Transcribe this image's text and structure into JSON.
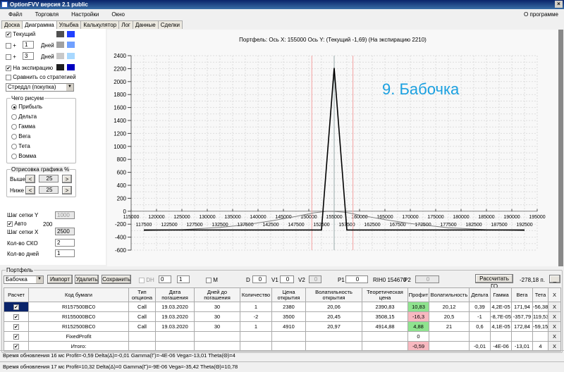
{
  "window": {
    "title": "OptionFVV версия 2.1 public"
  },
  "menu": [
    "Файл",
    "Торговля",
    "Настройки",
    "Окно"
  ],
  "about": "О программе",
  "tabs": [
    "Доска",
    "Диаграмма",
    "Улыбка",
    "Калькулятор",
    "Лог",
    "Данные",
    "Сделки"
  ],
  "left": {
    "current": "Текущий",
    "plus": "+",
    "days": "Дней",
    "days1": "1",
    "days2": "3",
    "expiry": "На экспирацию",
    "compare": "Сравнить со стратегией",
    "strategy": "Стреддл (покупка)",
    "draw_group": "Чего рисуем",
    "draw_options": [
      "Прибыль",
      "Дельта",
      "Гамма",
      "Вега",
      "Тета",
      "Вомма"
    ],
    "range_group": "Отрисовка графика %",
    "above": "Выше",
    "below": "Ниже",
    "above_val": "25",
    "below_val": "25",
    "lt": "<",
    "gt": ">",
    "grid_y": "Шаг сетки Y",
    "grid_y_val": "1000",
    "auto": "Авто",
    "auto_val": "200",
    "grid_x": "Шаг сетки X",
    "grid_x_val": "2500",
    "sko": "Кол-во СКО",
    "sko_val": "2",
    "ndays": "Кол-во дней",
    "ndays_val": "1",
    "colors": {
      "current": [
        "#505050",
        "#2040ff"
      ],
      "d1": [
        "#a0a0a0",
        "#70a0ff"
      ],
      "d3": [
        "#c8c8c8",
        "#a8d8ff"
      ],
      "expiry": [
        "#202020",
        "#0000c0"
      ]
    }
  },
  "chart_data": {
    "type": "line",
    "title": "Портфель: Ось X: 155000 Ось Y:  (Текущий -1,69)  (На экспирацию 2210)",
    "annotation": "9. Бабочка",
    "xlim": [
      115000,
      195000
    ],
    "ylim": [
      -600,
      2400
    ],
    "xticks": [
      115000,
      120000,
      125000,
      130000,
      135000,
      140000,
      145000,
      150000,
      155000,
      160000,
      165000,
      170000,
      175000,
      180000,
      185000,
      190000,
      195000
    ],
    "xticks2": [
      117500,
      122500,
      127500,
      132500,
      137500,
      142500,
      147500,
      152500,
      157500,
      162500,
      167500,
      172500,
      177500,
      182500,
      187500,
      192500
    ],
    "yticks": [
      2400,
      2200,
      2000,
      1800,
      1600,
      1400,
      1200,
      1000,
      800,
      600,
      400,
      200,
      0,
      -200,
      -400,
      -600
    ],
    "grid": true,
    "vlines_red": [
      150600,
      158700
    ],
    "cursor_x": 155000,
    "series": [
      {
        "name": "На экспирацию",
        "color": "#000000",
        "x": [
          117500,
          152500,
          155000,
          157500,
          192500
        ],
        "y": [
          -290,
          -290,
          2210,
          -290,
          -290
        ]
      },
      {
        "name": "Текущий",
        "color": "#808080",
        "x": [
          117500,
          125000,
          132500,
          137500,
          142500,
          147500,
          151000,
          153500,
          155000,
          157500,
          160000,
          165000,
          170000,
          177500,
          185000,
          192500
        ],
        "y": [
          -300,
          -285,
          -250,
          -210,
          -150,
          -80,
          -25,
          -2,
          -2,
          -20,
          -60,
          -130,
          -190,
          -255,
          -285,
          -300
        ]
      }
    ]
  },
  "portfolio": {
    "group": "Портфель",
    "name": "Бабочка",
    "import": "Импорт",
    "delete": "Удалить",
    "save": "Сохранить",
    "dh": "DH",
    "spin1": "0",
    "spin2": "1",
    "m": "M",
    "d": "D",
    "d_val": "0",
    "v1": "V1",
    "v1_val": "0",
    "v2": "V2",
    "v2_val": "0",
    "p1": "P1",
    "p1_val": "0",
    "rih": "RIH0 154670",
    "p2": "P2",
    "p2_val": "0",
    "calc_go": "Рассчитать ГО",
    "go_val": "-278,18 п.",
    "min": "_",
    "headers": [
      "Расчет",
      "Код бумаги",
      "Тип опциона",
      "Дата погашения",
      "Дней до погашения",
      "Количество",
      "Цена открытия",
      "Волатильность открытия",
      "Теоретическая цена",
      "Профит",
      "Волатильность",
      "Дельта",
      "Гамма",
      "Вега",
      "Тета",
      "X"
    ],
    "rows": [
      [
        "RI157500BC0",
        "Call",
        "19.03.2020",
        "30",
        "1",
        "2380",
        "20,06",
        "2390,83",
        "10,83",
        "20,12",
        "0,39",
        "4,2E-05",
        "171,94",
        "-56,38"
      ],
      [
        "RI155000BC0",
        "Call",
        "19.03.2020",
        "30",
        "-2",
        "3500",
        "20,45",
        "3508,15",
        "-16,3",
        "20,5",
        "-1",
        "-8,7E-05",
        "-357,79",
        "119,53"
      ],
      [
        "RI152500BC0",
        "Call",
        "19.03.2020",
        "30",
        "1",
        "4910",
        "20,97",
        "4914,88",
        "4,88",
        "21",
        "0,6",
        "4,1E-05",
        "172,84",
        "-59,15"
      ],
      [
        "FixedProfit",
        "",
        "",
        "",
        "",
        "",
        "",
        "",
        "0",
        "",
        "",
        "",
        "",
        ""
      ],
      [
        "Итого:",
        "",
        "",
        "",
        "",
        "",
        "",
        "",
        "-0,59",
        "",
        "-0,01",
        "-4E-06",
        "-13,01",
        "4"
      ]
    ],
    "profit_colors": [
      "g",
      "r",
      "g",
      "",
      "r"
    ]
  },
  "status": [
    "Время обновления 16 мс  Profit=-0,59 Delta(Δ)=-0,01 Gamma(Γ)=-4E-06 Vega=-13,01 Theta(Θ)=4",
    "Время обновления 17 мс  Profit=10,32 Delta(Δ)=0 Gamma(Γ)=-9E-06 Vega=-35,42 Theta(Θ)=10,78"
  ]
}
